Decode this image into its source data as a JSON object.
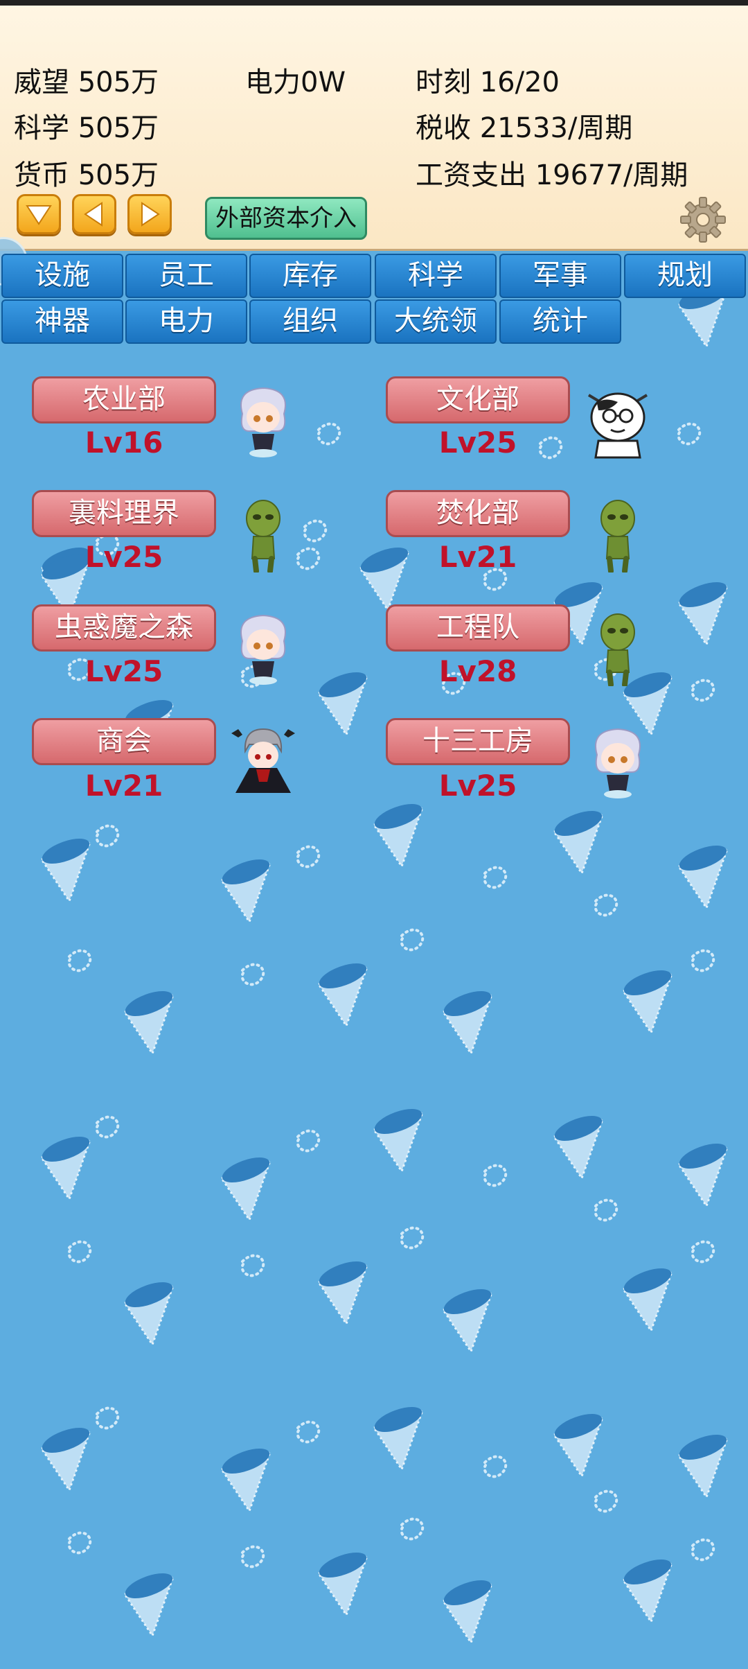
{
  "stats": {
    "prestige": "威望 505万",
    "power": "电力0W",
    "time": "时刻 16/20",
    "science": "科学 505万",
    "tax": "税收 21533/周期",
    "currency": "货币 505万",
    "wages": "工资支出 19677/周期"
  },
  "controls": {
    "down_icon": "arrow-down-icon",
    "left_icon": "arrow-left-icon",
    "right_icon": "arrow-right-icon",
    "capital_button": "外部资本介入",
    "settings_icon": "gear-icon"
  },
  "tabs": [
    "设施",
    "员工",
    "库存",
    "科学",
    "军事",
    "规划",
    "神器",
    "电力",
    "组织",
    "大统领",
    "统计"
  ],
  "departments": [
    {
      "name": "农业部",
      "level": "Lv16",
      "avatar": "silver-hair-girl"
    },
    {
      "name": "文化部",
      "level": "Lv25",
      "avatar": "cow-with-glasses"
    },
    {
      "name": "裏料理界",
      "level": "Lv25",
      "avatar": "green-goblin"
    },
    {
      "name": "焚化部",
      "level": "Lv21",
      "avatar": "green-goblin"
    },
    {
      "name": "虫惑魔之森",
      "level": "Lv25",
      "avatar": "silver-hair-girl"
    },
    {
      "name": "工程队",
      "level": "Lv28",
      "avatar": "green-goblin"
    },
    {
      "name": "商会",
      "level": "Lv21",
      "avatar": "vampire"
    },
    {
      "name": "十三工房",
      "level": "Lv25",
      "avatar": "silver-hair-girl"
    }
  ],
  "colors": {
    "background": "#5dade0",
    "header": "#fbe7c4",
    "tab": "#2383d2",
    "dept_button": "#e08286",
    "level_text": "#c0122a"
  }
}
